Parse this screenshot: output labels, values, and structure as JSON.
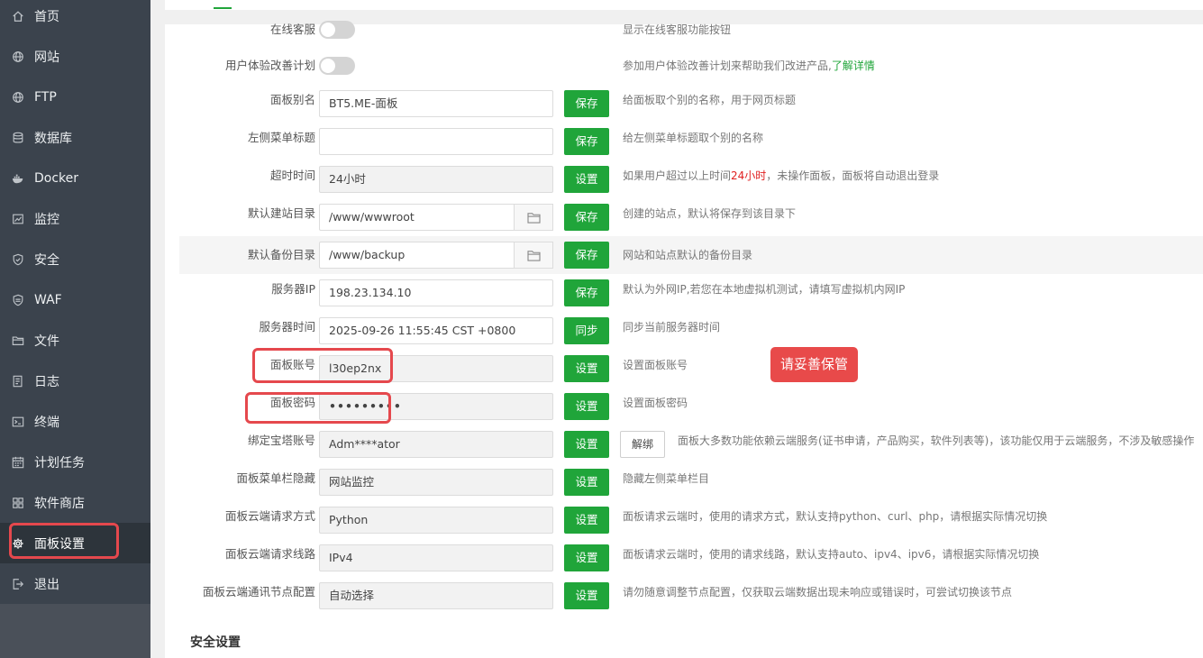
{
  "sidebar": {
    "items": [
      {
        "label": "首页",
        "icon": "home-icon"
      },
      {
        "label": "网站",
        "icon": "globe-icon"
      },
      {
        "label": "FTP",
        "icon": "ftp-globe-icon"
      },
      {
        "label": "数据库",
        "icon": "database-icon"
      },
      {
        "label": "Docker",
        "icon": "docker-icon"
      },
      {
        "label": "监控",
        "icon": "monitor-chart-icon"
      },
      {
        "label": "安全",
        "icon": "shield-icon"
      },
      {
        "label": "WAF",
        "icon": "waf-shield-icon"
      },
      {
        "label": "文件",
        "icon": "folder-icon"
      },
      {
        "label": "日志",
        "icon": "log-icon"
      },
      {
        "label": "终端",
        "icon": "terminal-icon"
      },
      {
        "label": "计划任务",
        "icon": "calendar-icon"
      },
      {
        "label": "软件商店",
        "icon": "grid-icon"
      },
      {
        "label": "面板设置",
        "icon": "gear-icon"
      },
      {
        "label": "退出",
        "icon": "logout-icon"
      }
    ],
    "active": "面板设置"
  },
  "settings": {
    "online_service": {
      "label": "在线客服",
      "desc": "显示在线客服功能按钮"
    },
    "ux_plan": {
      "label": "用户体验改善计划",
      "desc": "参加用户体验改善计划来帮助我们改进产品,",
      "link": "了解详情"
    },
    "panel_alias": {
      "label": "面板别名",
      "value": "BT5.ME-面板",
      "button": "保存",
      "desc": "给面板取个别的名称，用于网页标题"
    },
    "left_menu_title": {
      "label": "左侧菜单标题",
      "value": "",
      "button": "保存",
      "desc": "给左侧菜单标题取个别的名称"
    },
    "timeout": {
      "label": "超时时间",
      "value": "24小时",
      "button": "设置",
      "desc_pre": "如果用户超过以上时间",
      "desc_red": "24小时",
      "desc_post": "，未操作面板，面板将自动退出登录"
    },
    "default_site_dir": {
      "label": "默认建站目录",
      "value": "/www/wwwroot",
      "button": "保存",
      "desc": "创建的站点，默认将保存到该目录下"
    },
    "default_backup_dir": {
      "label": "默认备份目录",
      "value": "/www/backup",
      "button": "保存",
      "desc": "网站和站点默认的备份目录"
    },
    "server_ip": {
      "label": "服务器IP",
      "value": "198.23.134.10",
      "button": "保存",
      "desc": "默认为外网IP,若您在本地虚拟机测试，请填写虚拟机内网IP"
    },
    "server_time": {
      "label": "服务器时间",
      "value": "2025-09-26 11:55:45 CST +0800",
      "button": "同步",
      "desc": "同步当前服务器时间"
    },
    "panel_account": {
      "label": "面板账号",
      "value": "l30ep2nx",
      "button": "设置",
      "desc": "设置面板账号"
    },
    "panel_password": {
      "label": "面板密码",
      "value": "•••••••••",
      "button": "设置",
      "desc": "设置面板密码"
    },
    "bt_account": {
      "label": "绑定宝塔账号",
      "value": "Adm****ator",
      "button": "设置",
      "button2": "解绑",
      "desc": "面板大多数功能依赖云端服务(证书申请，产品购买，软件列表等)，该功能仅用于云端服务，不涉及敏感操作"
    },
    "menu_hide": {
      "label": "面板菜单栏隐藏",
      "value": "网站监控",
      "button": "设置",
      "desc": "隐藏左侧菜单栏目"
    },
    "cloud_request_method": {
      "label": "面板云端请求方式",
      "value": "Python",
      "button": "设置",
      "desc": "面板请求云端时，使用的请求方式，默认支持python、curl、php，请根据实际情况切换"
    },
    "cloud_request_line": {
      "label": "面板云端请求线路",
      "value": "IPv4",
      "button": "设置",
      "desc": "面板请求云端时，使用的请求线路，默认支持auto、ipv4、ipv6，请根据实际情况切换"
    },
    "cloud_node": {
      "label": "面板云端通讯节点配置",
      "value": "自动选择",
      "button": "设置",
      "desc": "请勿随意调整节点配置，仅获取云端数据出现未响应或错误时，可尝试切换该节点"
    }
  },
  "section_security": "安全设置",
  "annotation_note": "请妥善保管",
  "colors": {
    "sidebar_bg": "#3b434d",
    "accent": "#20a53a",
    "annotation": "#e5484d"
  }
}
